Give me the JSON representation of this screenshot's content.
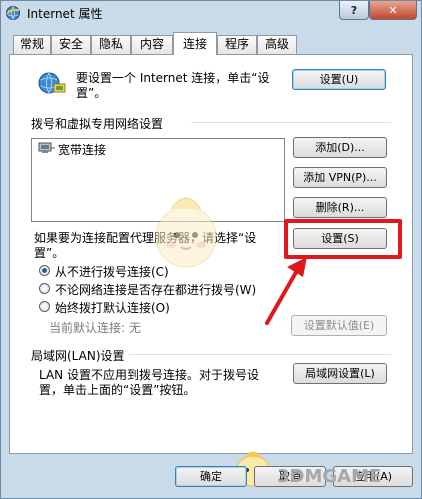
{
  "window": {
    "title": "Internet 属性",
    "help_symbol": "?",
    "close_symbol": "✕"
  },
  "tabs": [
    {
      "label": "常规",
      "active": false
    },
    {
      "label": "安全",
      "active": false
    },
    {
      "label": "隐私",
      "active": false
    },
    {
      "label": "内容",
      "active": false
    },
    {
      "label": "连接",
      "active": true
    },
    {
      "label": "程序",
      "active": false
    },
    {
      "label": "高级",
      "active": false
    }
  ],
  "setup": {
    "text_line1": "要设置一个 Internet 连接，单击“设",
    "text_line2": "置”。",
    "button": "设置(U)"
  },
  "dialup": {
    "heading": "拨号和虚拟专用网络设置",
    "items": [
      "宽带连接"
    ],
    "add_button": "添加(D)...",
    "add_vpn_button": "添加 VPN(P)...",
    "remove_button": "删除(R)...",
    "proxy_text_line1": "如果要为连接配置代理服务器，请选择“设",
    "proxy_text_line2": "置”。",
    "settings_button": "设置(S)",
    "options": [
      {
        "label": "从不进行拨号连接(C)",
        "checked": true
      },
      {
        "label": "不论网络连接是否存在都进行拨号(W)",
        "checked": false
      },
      {
        "label": "始终拨打默认连接(O)",
        "checked": false
      }
    ],
    "current_default_label": "当前默认连接:",
    "current_default_value": "无",
    "set_default_button": "设置默认值(E)"
  },
  "lan": {
    "heading": "局域网(LAN)设置",
    "text_line1": "LAN 设置不应用到拨号连接。对于拨号设",
    "text_line2": "置，单击上面的“设置”按钮。",
    "button": "局域网设置(L)"
  },
  "footer": {
    "ok_button": "确定",
    "cancel_button": "取消",
    "apply_button": "应用(A)"
  },
  "watermark": "3DMGAME",
  "annotation_color": "#e0181c"
}
